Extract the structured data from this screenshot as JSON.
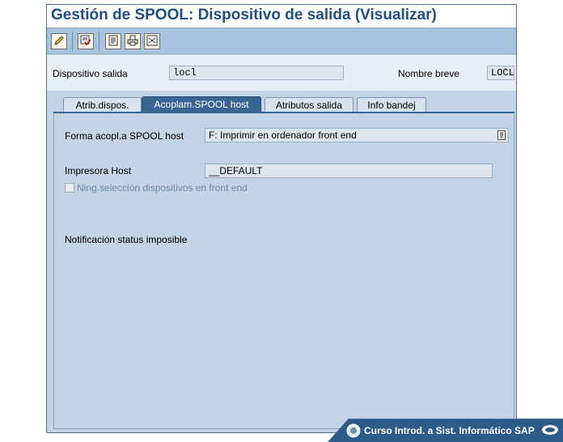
{
  "title": "Gestión de SPOOL: Dispositivo de salida (Visualizar)",
  "toolbar": {
    "icons": [
      "pencil-icon",
      "check-list-icon",
      "form-icon",
      "printer-icon",
      "list-check-icon"
    ]
  },
  "header": {
    "device_label": "Dispositivo salida",
    "device_value": "locl",
    "short_name_label": "Nombre breve",
    "short_name_value": "LOCL"
  },
  "tabs": [
    {
      "label": "Atrib.dispos.",
      "active": false
    },
    {
      "label": "Acoplam.SPOOL host",
      "active": true
    },
    {
      "label": "Atributos salida",
      "active": false
    },
    {
      "label": "Info bandej",
      "active": false
    }
  ],
  "panel": {
    "coupling_label": "Forma acopl.a SPOOL host",
    "coupling_value": "F: Imprimir en ordenador front end",
    "host_printer_label": "Impresora Host",
    "host_printer_value": "__DEFAULT",
    "no_frontend_selection_label": "Ning.selección dispositivos en front end",
    "status_text": "Notificación status imposible"
  },
  "footer": {
    "course_text": "Curso Introd. a Sist. Informático SAP"
  },
  "colors": {
    "title": "#1f4f86",
    "toolbar": "#a8c3df",
    "active_tab": "#3a6592",
    "panel": "#c2d4e6"
  }
}
